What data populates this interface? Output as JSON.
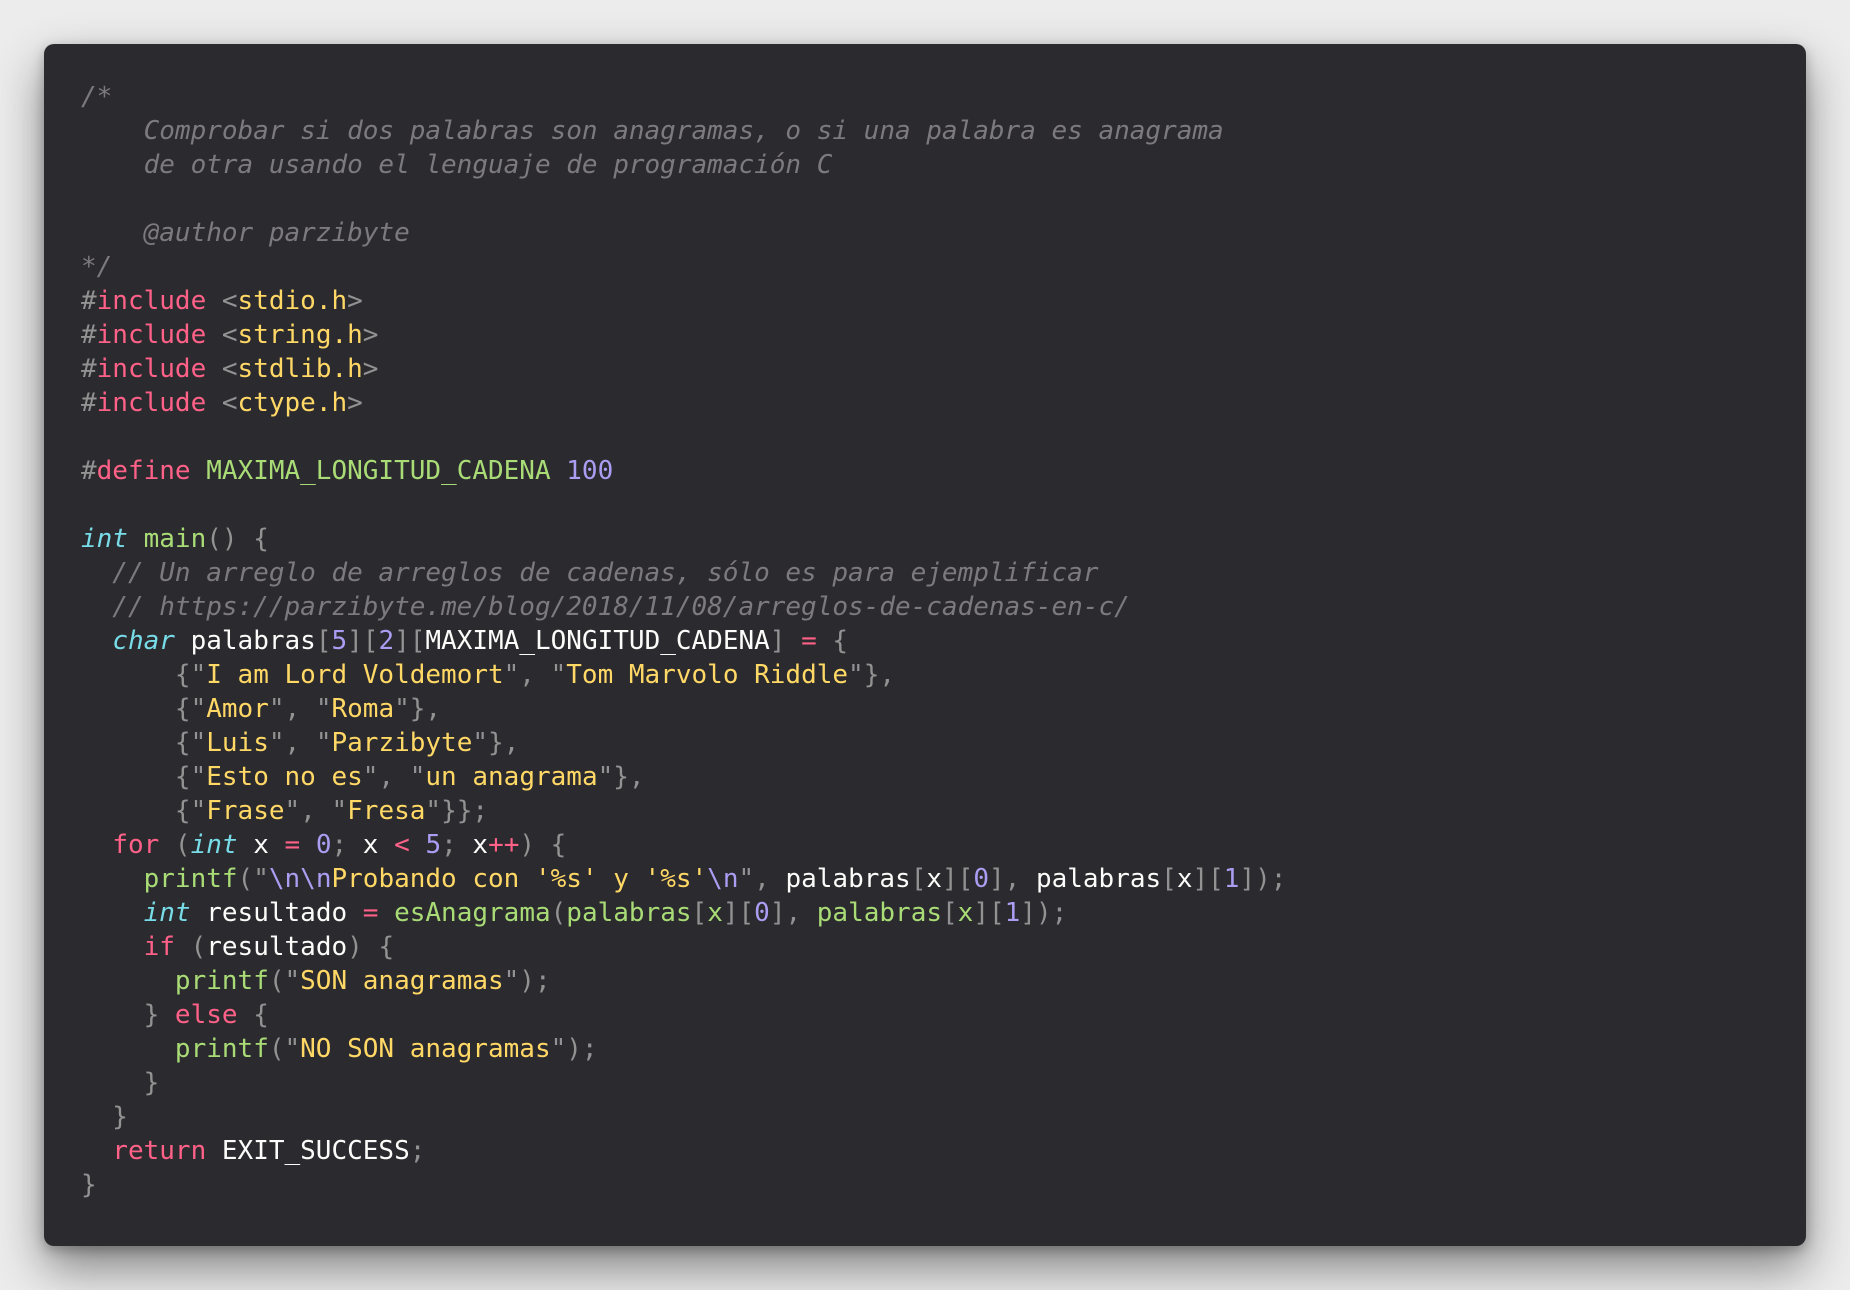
{
  "editor": {
    "language": "C",
    "lines": [
      [
        {
          "c": "cm",
          "t": "/*"
        }
      ],
      [
        {
          "c": "cm",
          "t": "    Comprobar si dos palabras son anagramas, o si una palabra es anagrama"
        }
      ],
      [
        {
          "c": "cm",
          "t": "    de otra usando el lenguaje de programación C"
        }
      ],
      [],
      [
        {
          "c": "cm",
          "t": "    @author parzibyte"
        }
      ],
      [
        {
          "c": "cm",
          "t": "*/"
        }
      ],
      [
        {
          "c": "pu",
          "t": "#"
        },
        {
          "c": "kw",
          "t": "include"
        },
        {
          "c": "pu",
          "t": " <"
        },
        {
          "c": "st",
          "t": "stdio.h"
        },
        {
          "c": "pu",
          "t": ">"
        }
      ],
      [
        {
          "c": "pu",
          "t": "#"
        },
        {
          "c": "kw",
          "t": "include"
        },
        {
          "c": "pu",
          "t": " <"
        },
        {
          "c": "st",
          "t": "string.h"
        },
        {
          "c": "pu",
          "t": ">"
        }
      ],
      [
        {
          "c": "pu",
          "t": "#"
        },
        {
          "c": "kw",
          "t": "include"
        },
        {
          "c": "pu",
          "t": " <"
        },
        {
          "c": "st",
          "t": "stdlib.h"
        },
        {
          "c": "pu",
          "t": ">"
        }
      ],
      [
        {
          "c": "pu",
          "t": "#"
        },
        {
          "c": "kw",
          "t": "include"
        },
        {
          "c": "pu",
          "t": " <"
        },
        {
          "c": "st",
          "t": "ctype.h"
        },
        {
          "c": "pu",
          "t": ">"
        }
      ],
      [],
      [
        {
          "c": "pu",
          "t": "#"
        },
        {
          "c": "kw",
          "t": "define"
        },
        {
          "c": "id",
          "t": " "
        },
        {
          "c": "fn",
          "t": "MAXIMA_LONGITUD_CADENA"
        },
        {
          "c": "id",
          "t": " "
        },
        {
          "c": "nu",
          "t": "100"
        }
      ],
      [],
      [
        {
          "c": "ty",
          "t": "int"
        },
        {
          "c": "id",
          "t": " "
        },
        {
          "c": "fn",
          "t": "main"
        },
        {
          "c": "pu",
          "t": "() {"
        }
      ],
      [
        {
          "c": "cm",
          "t": "  // Un arreglo de arreglos de cadenas, sólo es para ejemplificar"
        }
      ],
      [
        {
          "c": "cm",
          "t": "  // https://parzibyte.me/blog/2018/11/08/arreglos-de-cadenas-en-c/"
        }
      ],
      [
        {
          "c": "id",
          "t": "  "
        },
        {
          "c": "ty",
          "t": "char"
        },
        {
          "c": "id",
          "t": " palabras"
        },
        {
          "c": "pu",
          "t": "["
        },
        {
          "c": "nu",
          "t": "5"
        },
        {
          "c": "pu",
          "t": "]["
        },
        {
          "c": "nu",
          "t": "2"
        },
        {
          "c": "pu",
          "t": "]["
        },
        {
          "c": "id",
          "t": "MAXIMA_LONGITUD_CADENA"
        },
        {
          "c": "pu",
          "t": "] "
        },
        {
          "c": "kw",
          "t": "="
        },
        {
          "c": "pu",
          "t": " {"
        }
      ],
      [
        {
          "c": "pu",
          "t": "      {\""
        },
        {
          "c": "st",
          "t": "I am Lord Voldemort"
        },
        {
          "c": "pu",
          "t": "\", \""
        },
        {
          "c": "st",
          "t": "Tom Marvolo Riddle"
        },
        {
          "c": "pu",
          "t": "\"},"
        }
      ],
      [
        {
          "c": "pu",
          "t": "      {\""
        },
        {
          "c": "st",
          "t": "Amor"
        },
        {
          "c": "pu",
          "t": "\", \""
        },
        {
          "c": "st",
          "t": "Roma"
        },
        {
          "c": "pu",
          "t": "\"},"
        }
      ],
      [
        {
          "c": "pu",
          "t": "      {\""
        },
        {
          "c": "st",
          "t": "Luis"
        },
        {
          "c": "pu",
          "t": "\", \""
        },
        {
          "c": "st",
          "t": "Parzibyte"
        },
        {
          "c": "pu",
          "t": "\"},"
        }
      ],
      [
        {
          "c": "pu",
          "t": "      {\""
        },
        {
          "c": "st",
          "t": "Esto no es"
        },
        {
          "c": "pu",
          "t": "\", \""
        },
        {
          "c": "st",
          "t": "un anagrama"
        },
        {
          "c": "pu",
          "t": "\"},"
        }
      ],
      [
        {
          "c": "pu",
          "t": "      {\""
        },
        {
          "c": "st",
          "t": "Frase"
        },
        {
          "c": "pu",
          "t": "\", \""
        },
        {
          "c": "st",
          "t": "Fresa"
        },
        {
          "c": "pu",
          "t": "\"}};"
        }
      ],
      [
        {
          "c": "id",
          "t": "  "
        },
        {
          "c": "kw",
          "t": "for"
        },
        {
          "c": "pu",
          "t": " ("
        },
        {
          "c": "ty",
          "t": "int"
        },
        {
          "c": "id",
          "t": " x "
        },
        {
          "c": "kw",
          "t": "="
        },
        {
          "c": "id",
          "t": " "
        },
        {
          "c": "nu",
          "t": "0"
        },
        {
          "c": "pu",
          "t": ";"
        },
        {
          "c": "id",
          "t": " x "
        },
        {
          "c": "kw",
          "t": "<"
        },
        {
          "c": "id",
          "t": " "
        },
        {
          "c": "nu",
          "t": "5"
        },
        {
          "c": "pu",
          "t": ";"
        },
        {
          "c": "id",
          "t": " x"
        },
        {
          "c": "kw",
          "t": "++"
        },
        {
          "c": "pu",
          "t": ") {"
        }
      ],
      [
        {
          "c": "id",
          "t": "    "
        },
        {
          "c": "fn",
          "t": "printf"
        },
        {
          "c": "pu",
          "t": "(\""
        },
        {
          "c": "es",
          "t": "\\n\\n"
        },
        {
          "c": "st",
          "t": "Probando con '%s' y '%s'"
        },
        {
          "c": "es",
          "t": "\\n"
        },
        {
          "c": "pu",
          "t": "\", "
        },
        {
          "c": "id",
          "t": "palabras"
        },
        {
          "c": "pu",
          "t": "["
        },
        {
          "c": "id",
          "t": "x"
        },
        {
          "c": "pu",
          "t": "]["
        },
        {
          "c": "nu",
          "t": "0"
        },
        {
          "c": "pu",
          "t": "], "
        },
        {
          "c": "id",
          "t": "palabras"
        },
        {
          "c": "pu",
          "t": "["
        },
        {
          "c": "id",
          "t": "x"
        },
        {
          "c": "pu",
          "t": "]["
        },
        {
          "c": "nu",
          "t": "1"
        },
        {
          "c": "pu",
          "t": "]);"
        }
      ],
      [
        {
          "c": "id",
          "t": "    "
        },
        {
          "c": "ty",
          "t": "int"
        },
        {
          "c": "id",
          "t": " resultado "
        },
        {
          "c": "kw",
          "t": "="
        },
        {
          "c": "id",
          "t": " "
        },
        {
          "c": "fn",
          "t": "esAnagrama"
        },
        {
          "c": "pu",
          "t": "("
        },
        {
          "c": "fn",
          "t": "palabras"
        },
        {
          "c": "pu",
          "t": "["
        },
        {
          "c": "fn",
          "t": "x"
        },
        {
          "c": "pu",
          "t": "]["
        },
        {
          "c": "nu",
          "t": "0"
        },
        {
          "c": "pu",
          "t": "], "
        },
        {
          "c": "fn",
          "t": "palabras"
        },
        {
          "c": "pu",
          "t": "["
        },
        {
          "c": "fn",
          "t": "x"
        },
        {
          "c": "pu",
          "t": "]["
        },
        {
          "c": "nu",
          "t": "1"
        },
        {
          "c": "pu",
          "t": "]);"
        }
      ],
      [
        {
          "c": "id",
          "t": "    "
        },
        {
          "c": "kw",
          "t": "if"
        },
        {
          "c": "pu",
          "t": " ("
        },
        {
          "c": "id",
          "t": "resultado"
        },
        {
          "c": "pu",
          "t": ") {"
        }
      ],
      [
        {
          "c": "id",
          "t": "      "
        },
        {
          "c": "fn",
          "t": "printf"
        },
        {
          "c": "pu",
          "t": "(\""
        },
        {
          "c": "st",
          "t": "SON anagramas"
        },
        {
          "c": "pu",
          "t": "\");"
        }
      ],
      [
        {
          "c": "pu",
          "t": "    } "
        },
        {
          "c": "kw",
          "t": "else"
        },
        {
          "c": "pu",
          "t": " {"
        }
      ],
      [
        {
          "c": "id",
          "t": "      "
        },
        {
          "c": "fn",
          "t": "printf"
        },
        {
          "c": "pu",
          "t": "(\""
        },
        {
          "c": "st",
          "t": "NO SON anagramas"
        },
        {
          "c": "pu",
          "t": "\");"
        }
      ],
      [
        {
          "c": "pu",
          "t": "    }"
        }
      ],
      [
        {
          "c": "pu",
          "t": "  }"
        }
      ],
      [
        {
          "c": "id",
          "t": "  "
        },
        {
          "c": "kw",
          "t": "return"
        },
        {
          "c": "id",
          "t": " EXIT_SUCCESS"
        },
        {
          "c": "pu",
          "t": ";"
        }
      ],
      [
        {
          "c": "pu",
          "t": "}"
        }
      ]
    ]
  },
  "colors": {
    "background": "#2b2a2e",
    "page": "#ececec",
    "comment": "#7c7a7f",
    "keyword": "#ff6188",
    "type": "#78dce8",
    "function": "#a9dc76",
    "string": "#ffd866",
    "number": "#ab9df2",
    "punctuation": "#939293",
    "identifier": "#fcfcfa"
  }
}
